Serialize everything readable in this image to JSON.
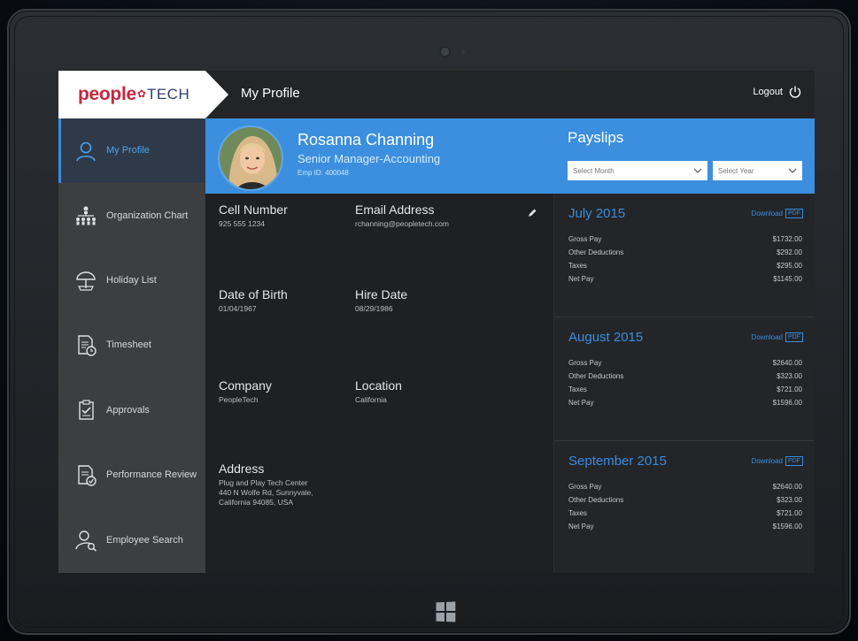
{
  "app": {
    "logo_left": "people",
    "logo_right": "TECH",
    "page_title": "My Profile",
    "logout_label": "Logout"
  },
  "sidebar": {
    "items": [
      {
        "label": "My Profile",
        "icon": "user-icon"
      },
      {
        "label": "Organization Chart",
        "icon": "org-chart-icon"
      },
      {
        "label": "Holiday List",
        "icon": "umbrella-icon"
      },
      {
        "label": "Timesheet",
        "icon": "timesheet-icon"
      },
      {
        "label": "Approvals",
        "icon": "approvals-icon"
      },
      {
        "label": "Performance Review",
        "icon": "review-icon"
      },
      {
        "label": "Employee Search",
        "icon": "user-search-icon"
      }
    ]
  },
  "profile": {
    "name": "Rosanna Channing",
    "title": "Senior Manager-Accounting",
    "emp_id": "Emp ID: 400048",
    "fields": {
      "cell_label": "Cell Number",
      "cell_value": "925 555 1234",
      "email_label": "Email Address",
      "email_value": "rchanning@peopletech.com",
      "dob_label": "Date of Birth",
      "dob_value": "01/04/1967",
      "hire_label": "Hire Date",
      "hire_value": "08/29/1986",
      "company_label": "Company",
      "company_value": "PeopleTech",
      "location_label": "Location",
      "location_value": "California",
      "address_label": "Address",
      "address_line1": "Plug and Play Tech Center",
      "address_line2": "440 N Wolfe Rd, Sunnyvale,",
      "address_line3": "California 94085, USA"
    }
  },
  "payslips": {
    "title": "Payslips",
    "select_month": "Select Month",
    "select_year": "Select Year",
    "download_label": "Download",
    "pdf_label": "PDF",
    "row_labels": {
      "gross": "Gross Pay",
      "other": "Other Deductions",
      "taxes": "Taxes",
      "net": "Net Pay"
    },
    "slips": [
      {
        "month": "July 2015",
        "gross": "$1732.00",
        "other": "$292.00",
        "taxes": "$295.00",
        "net": "$1145.00"
      },
      {
        "month": "August 2015",
        "gross": "$2640.00",
        "other": "$323.00",
        "taxes": "$721.00",
        "net": "$1596.00"
      },
      {
        "month": "September 2015",
        "gross": "$2640.00",
        "other": "$323.00",
        "taxes": "$721.00",
        "net": "$1596.00"
      }
    ]
  },
  "colors": {
    "accent": "#3b8fde",
    "brand_red": "#c5283d",
    "brand_navy": "#2e3f6f",
    "sidebar": "#3d3e40"
  }
}
